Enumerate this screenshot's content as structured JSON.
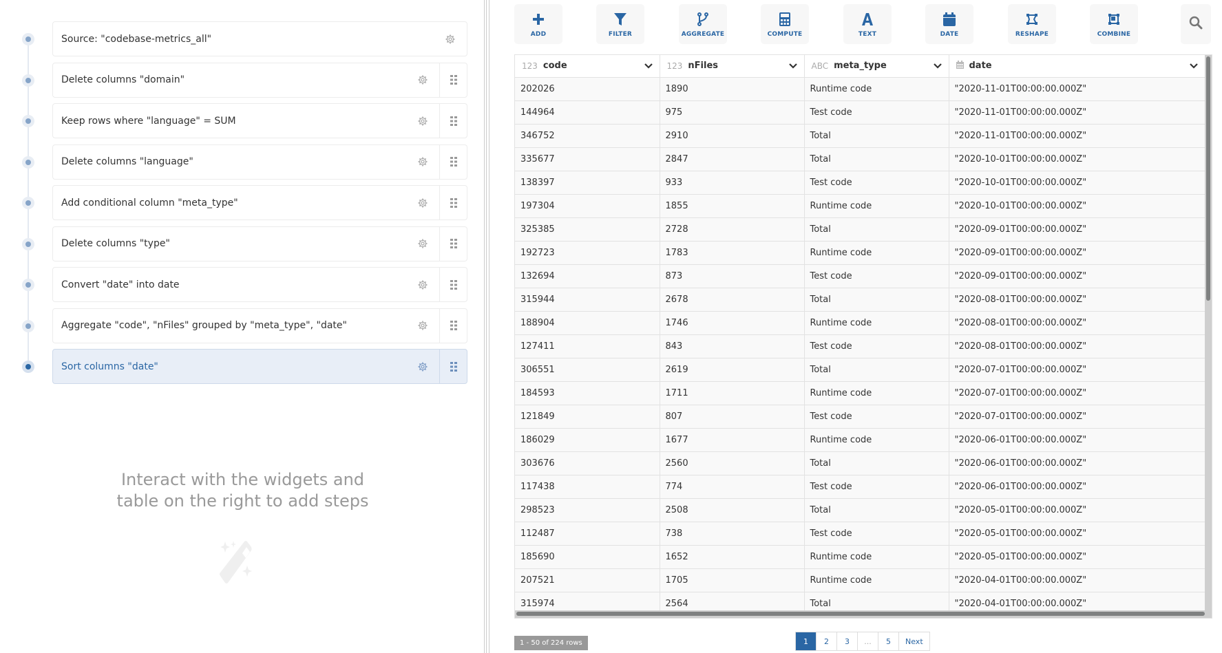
{
  "pipeline": {
    "steps": [
      {
        "label": "Source: \"codebase-metrics_all\"",
        "has_handle": false,
        "active": false
      },
      {
        "label": "Delete columns \"domain\"",
        "has_handle": true,
        "active": false
      },
      {
        "label": "Keep rows where \"language\" = SUM",
        "has_handle": true,
        "active": false
      },
      {
        "label": "Delete columns \"language\"",
        "has_handle": true,
        "active": false
      },
      {
        "label": "Add conditional column \"meta_type\"",
        "has_handle": true,
        "active": false
      },
      {
        "label": "Delete columns \"type\"",
        "has_handle": true,
        "active": false
      },
      {
        "label": "Convert \"date\" into date",
        "has_handle": true,
        "active": false
      },
      {
        "label": "Aggregate \"code\", \"nFiles\" grouped by \"meta_type\", \"date\"",
        "has_handle": true,
        "active": false
      },
      {
        "label": "Sort columns \"date\"",
        "has_handle": true,
        "active": true
      }
    ],
    "empty_message_line1": "Interact with the widgets and",
    "empty_message_line2": "table on the right to add steps"
  },
  "toolbar": {
    "buttons": [
      {
        "label": "ADD",
        "icon": "plus-icon"
      },
      {
        "label": "FILTER",
        "icon": "filter-icon"
      },
      {
        "label": "AGGREGATE",
        "icon": "aggregate-icon"
      },
      {
        "label": "COMPUTE",
        "icon": "calculator-icon"
      },
      {
        "label": "TEXT",
        "icon": "text-icon"
      },
      {
        "label": "DATE",
        "icon": "calendar-icon"
      },
      {
        "label": "RESHAPE",
        "icon": "reshape-icon"
      },
      {
        "label": "COMBINE",
        "icon": "combine-icon"
      }
    ],
    "search_icon": "search-icon"
  },
  "table": {
    "columns": [
      {
        "type": "123",
        "name": "code"
      },
      {
        "type": "123",
        "name": "nFiles"
      },
      {
        "type": "ABC",
        "name": "meta_type"
      },
      {
        "type": "calendar",
        "name": "date"
      }
    ],
    "rows": [
      [
        "202026",
        "1890",
        "Runtime code",
        "\"2020-11-01T00:00:00.000Z\""
      ],
      [
        "144964",
        "975",
        "Test code",
        "\"2020-11-01T00:00:00.000Z\""
      ],
      [
        "346752",
        "2910",
        "Total",
        "\"2020-11-01T00:00:00.000Z\""
      ],
      [
        "335677",
        "2847",
        "Total",
        "\"2020-10-01T00:00:00.000Z\""
      ],
      [
        "138397",
        "933",
        "Test code",
        "\"2020-10-01T00:00:00.000Z\""
      ],
      [
        "197304",
        "1855",
        "Runtime code",
        "\"2020-10-01T00:00:00.000Z\""
      ],
      [
        "325385",
        "2728",
        "Total",
        "\"2020-09-01T00:00:00.000Z\""
      ],
      [
        "192723",
        "1783",
        "Runtime code",
        "\"2020-09-01T00:00:00.000Z\""
      ],
      [
        "132694",
        "873",
        "Test code",
        "\"2020-09-01T00:00:00.000Z\""
      ],
      [
        "315944",
        "2678",
        "Total",
        "\"2020-08-01T00:00:00.000Z\""
      ],
      [
        "188904",
        "1746",
        "Runtime code",
        "\"2020-08-01T00:00:00.000Z\""
      ],
      [
        "127411",
        "843",
        "Test code",
        "\"2020-08-01T00:00:00.000Z\""
      ],
      [
        "306551",
        "2619",
        "Total",
        "\"2020-07-01T00:00:00.000Z\""
      ],
      [
        "184593",
        "1711",
        "Runtime code",
        "\"2020-07-01T00:00:00.000Z\""
      ],
      [
        "121849",
        "807",
        "Test code",
        "\"2020-07-01T00:00:00.000Z\""
      ],
      [
        "186029",
        "1677",
        "Runtime code",
        "\"2020-06-01T00:00:00.000Z\""
      ],
      [
        "303676",
        "2560",
        "Total",
        "\"2020-06-01T00:00:00.000Z\""
      ],
      [
        "117438",
        "774",
        "Test code",
        "\"2020-06-01T00:00:00.000Z\""
      ],
      [
        "298523",
        "2508",
        "Total",
        "\"2020-05-01T00:00:00.000Z\""
      ],
      [
        "112487",
        "738",
        "Test code",
        "\"2020-05-01T00:00:00.000Z\""
      ],
      [
        "185690",
        "1652",
        "Runtime code",
        "\"2020-05-01T00:00:00.000Z\""
      ],
      [
        "207521",
        "1705",
        "Runtime code",
        "\"2020-04-01T00:00:00.000Z\""
      ],
      [
        "315974",
        "2564",
        "Total",
        "\"2020-04-01T00:00:00.000Z\""
      ]
    ]
  },
  "footer": {
    "row_count": "1 - 50 of 224 rows",
    "pages": [
      "1",
      "2",
      "3",
      "...",
      "5",
      "Next"
    ],
    "current_page": "1"
  },
  "colors": {
    "accent": "#2a66a4",
    "active_step_bg": "#e8eef7",
    "row_bg": "#f9f9f9"
  }
}
